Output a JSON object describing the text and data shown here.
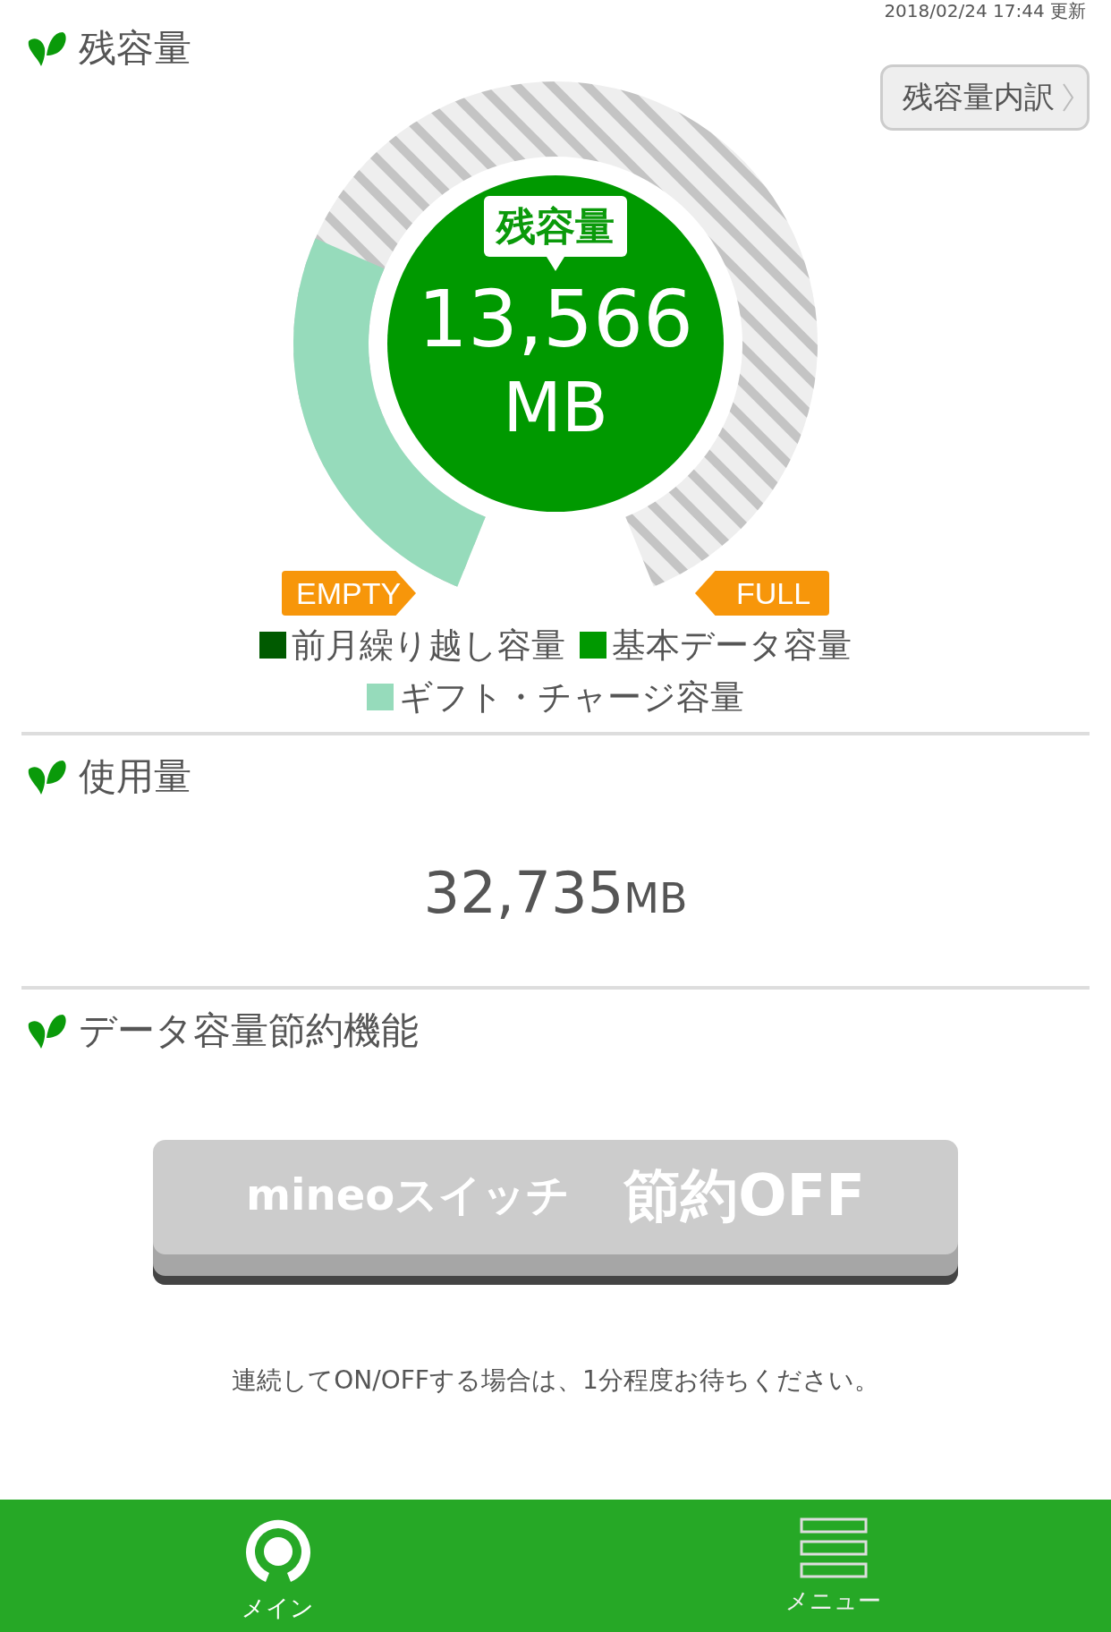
{
  "updated": "2018/02/24 17:44 更新",
  "remaining": {
    "title": "残容量",
    "detail_button": "残容量内訳",
    "bubble": "残容量",
    "value": "13,566",
    "unit": "MB",
    "empty_label": "EMPTY",
    "full_label": "FULL",
    "legend": [
      {
        "label": "前月繰り越し容量",
        "color": "#005a00"
      },
      {
        "label": "基本データ容量",
        "color": "#009900"
      },
      {
        "label": "ギフト・チャージ容量",
        "color": "#96dbbb"
      }
    ]
  },
  "usage": {
    "title": "使用量",
    "value": "32,735",
    "unit": "MB"
  },
  "saving": {
    "title": "データ容量節約機能",
    "switch": {
      "brand": "mineoスイッチ",
      "label": "節約OFF",
      "on": false
    },
    "note": "連続してON/OFFする場合は、1分程度お待ちください。"
  },
  "nav": [
    {
      "label": "メイン",
      "kind": "main",
      "selected": true
    },
    {
      "label": "メニュー",
      "kind": "menu",
      "selected": false
    }
  ]
}
